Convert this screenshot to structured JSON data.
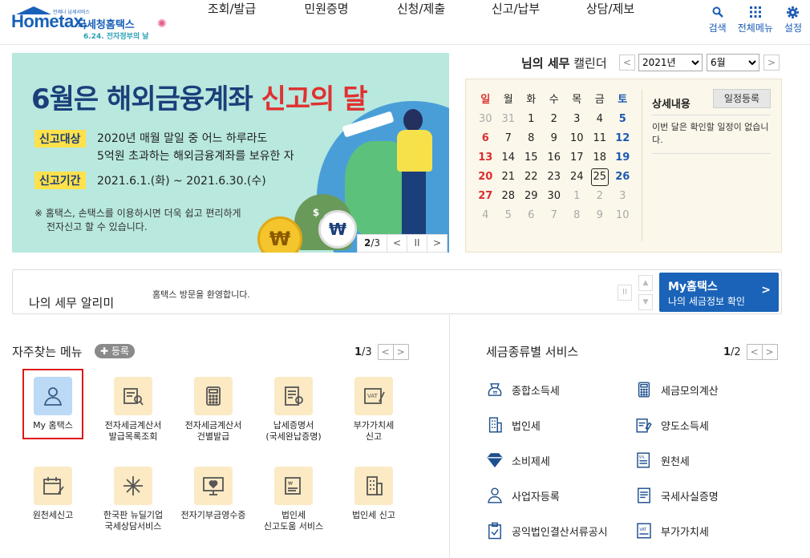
{
  "header": {
    "logo_text": "Hometax.",
    "logo_small": "언제나 납세서비스",
    "logo_name": "국세청홈택스",
    "logo_event": "6.24. 전자정부의 날",
    "nav": [
      "조회/발급",
      "민원증명",
      "신청/제출",
      "신고/납부",
      "상담/제보"
    ],
    "util": [
      {
        "label": "검색",
        "icon": "search-icon"
      },
      {
        "label": "전체메뉴",
        "icon": "grid-icon"
      },
      {
        "label": "설정",
        "icon": "gear-icon"
      }
    ]
  },
  "banner": {
    "title_a": "6월은 해외금융계좌 ",
    "title_b": "신고의 달",
    "tag1": "신고대상",
    "line1a": "2020년 매월 말일 중 어느 하루라도",
    "line1b": "5억원 초과하는 해외금융계좌를 보유한 자",
    "tag2": "신고기간",
    "line2": "2021.6.1.(화) ~ 2021.6.30.(수)",
    "note1": "※ 홈택스, 손택스를 이용하시면 더욱 쉽고 편리하게",
    "note2": "전자신고 할 수 있습니다.",
    "coin_symbol": "₩",
    "dollar_symbol": "$",
    "page_current": "2",
    "page_total": "/3",
    "prev": "<",
    "pause": "II",
    "next": ">"
  },
  "calendar": {
    "title_bold": "님의 세무",
    "title_rest": "캘린더",
    "prev": "<",
    "next": ">",
    "year": "2021년",
    "month": "6월",
    "weekdays": [
      "일",
      "월",
      "화",
      "수",
      "목",
      "금",
      "토"
    ],
    "weeks": [
      [
        "30",
        "31",
        "1",
        "2",
        "3",
        "4",
        "5"
      ],
      [
        "6",
        "7",
        "8",
        "9",
        "10",
        "11",
        "12"
      ],
      [
        "13",
        "14",
        "15",
        "16",
        "17",
        "18",
        "19"
      ],
      [
        "20",
        "21",
        "22",
        "23",
        "24",
        "25",
        "26"
      ],
      [
        "27",
        "28",
        "29",
        "30",
        "1",
        "2",
        "3"
      ],
      [
        "4",
        "5",
        "6",
        "7",
        "8",
        "9",
        "10"
      ]
    ],
    "today": "25",
    "detail_title": "상세내용",
    "add_label": "일정등록",
    "detail_text": "이번 달은 확인할 일정이 없습니다."
  },
  "alarm": {
    "title": "나의 세무 알리미",
    "message": "홈택스 방문을 환영합니다.",
    "pause": "II",
    "up": "▲",
    "down": "▼",
    "my_title": "My홈택스",
    "my_sub": "나의 세금정보 확인",
    "my_chevron": ">"
  },
  "favorites": {
    "title": "자주찾는 메뉴",
    "register": "등록",
    "page_current": "1",
    "page_total": "/3",
    "prev": "<",
    "next": ">",
    "items": [
      {
        "label": "My 홈택스",
        "icon": "user-icon"
      },
      {
        "label": "전자세금계산서\n발급목록조회",
        "icon": "invoice-search-icon"
      },
      {
        "label": "전자세금계산서\n건별발급",
        "icon": "calculator-icon"
      },
      {
        "label": "납세증명서\n(국세완납증명)",
        "icon": "certificate-icon"
      },
      {
        "label": "부가가치세\n신고",
        "icon": "vat-report-icon"
      },
      {
        "label": "원천세신고",
        "icon": "calendar-edit-icon"
      },
      {
        "label": "한국판 뉴딜기업\n국세상담서비스",
        "icon": "newdeal-icon"
      },
      {
        "label": "전자기부금영수증",
        "icon": "donation-icon"
      },
      {
        "label": "법인세\n신고도움 서비스",
        "icon": "corp-help-icon"
      },
      {
        "label": "법인세 신고",
        "icon": "building-icon"
      }
    ]
  },
  "tax_services": {
    "title": "세금종류별 서비스",
    "page_current": "1",
    "page_total": "/2",
    "prev": "<",
    "next": ">",
    "items": [
      {
        "label": "종합소득세",
        "icon": "money-bag-icon"
      },
      {
        "label": "세금모의계산",
        "icon": "calculator-icon"
      },
      {
        "label": "법인세",
        "icon": "building-icon"
      },
      {
        "label": "양도소득세",
        "icon": "transfer-doc-icon"
      },
      {
        "label": "소비제세",
        "icon": "diamond-icon"
      },
      {
        "label": "원천세",
        "icon": "salary-doc-icon"
      },
      {
        "label": "사업자등록",
        "icon": "person-icon"
      },
      {
        "label": "국세사실증명",
        "icon": "document-icon"
      },
      {
        "label": "공익법인결산서류공시",
        "icon": "clipboard-check-icon"
      },
      {
        "label": "부가가치세",
        "icon": "vat-doc-icon"
      }
    ]
  }
}
